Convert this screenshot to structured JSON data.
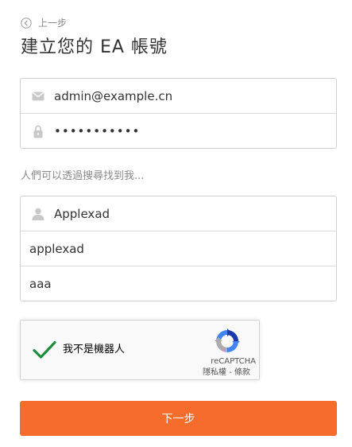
{
  "header": {
    "back_label": "上一步",
    "title": "建立您的 EA 帳號"
  },
  "account": {
    "email": {
      "value": "admin@example.cn",
      "icon": "envelope-icon"
    },
    "password": {
      "value": "•••••••••••",
      "icon": "lock-icon"
    }
  },
  "profile": {
    "section_label": "人們可以透過搜尋找到我...",
    "id_field": {
      "value": "Applexad",
      "icon": "user-icon"
    },
    "first_name": {
      "value": "applexad"
    },
    "last_name": {
      "value": "aaa"
    }
  },
  "recaptcha": {
    "label": "我不是機器人",
    "brand": "reCAPTCHA",
    "privacy": "隱私權",
    "separator": " - ",
    "terms": "條款",
    "checked": true,
    "check_color": "#1e8e3e"
  },
  "actions": {
    "next_label": "下一步",
    "next_color": "#f56c2d"
  }
}
